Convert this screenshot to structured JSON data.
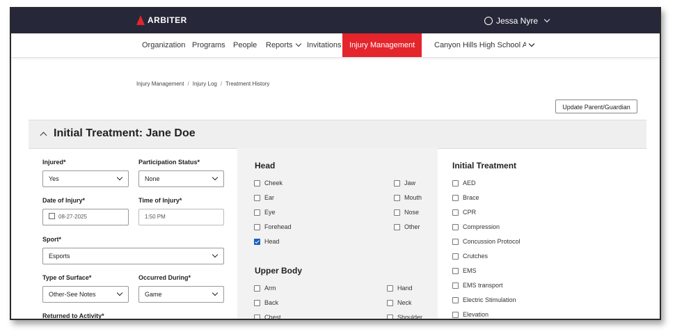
{
  "header": {
    "logo_text": "ARBITER",
    "user_name": "Jessa Nyre"
  },
  "nav": {
    "items": [
      "Organization",
      "Programs",
      "People",
      "Reports",
      "Invitations",
      "Injury Management",
      "Canyon Hills High School Acc"
    ]
  },
  "breadcrumb": [
    "Injury Management",
    "Injury Log",
    "Treatment History"
  ],
  "actions": {
    "update_parent": "Update Parent/Guardian"
  },
  "section": {
    "title": "Initial Treatment: Jane Doe"
  },
  "form": {
    "injured": {
      "label": "Injured*",
      "value": "Yes"
    },
    "participation": {
      "label": "Participation Status*",
      "value": "None"
    },
    "date": {
      "label": "Date of Injury*",
      "value": "08-27-2025"
    },
    "time": {
      "label": "Time of Injury*",
      "value": "1:50 PM"
    },
    "sport": {
      "label": "Sport*",
      "value": "Esports"
    },
    "surface": {
      "label": "Type of Surface*",
      "value": "Other-See Notes"
    },
    "occurred": {
      "label": "Occurred During*",
      "value": "Game"
    },
    "returned": {
      "label": "Returned to Activity*"
    }
  },
  "head": {
    "title": "Head",
    "left": [
      "Cheek",
      "Ear",
      "Eye",
      "Forehead",
      "Head"
    ],
    "right": [
      "Jaw",
      "Mouth",
      "Nose",
      "Other"
    ],
    "checked": [
      "Head"
    ]
  },
  "upper_body": {
    "title": "Upper Body",
    "left": [
      "Arm",
      "Back",
      "Chest"
    ],
    "right": [
      "Hand",
      "Neck",
      "Shoulder"
    ]
  },
  "initial_treatment": {
    "title": "Initial Treatment",
    "items": [
      "AED",
      "Brace",
      "CPR",
      "Compression",
      "Concussion Protocol",
      "Crutches",
      "EMS",
      "EMS transport",
      "Electric Stimulation",
      "Elevation"
    ]
  },
  "colors": {
    "topbar": "#262839",
    "accent": "#e4252c",
    "checkbox_checked": "#1f5fbf"
  }
}
